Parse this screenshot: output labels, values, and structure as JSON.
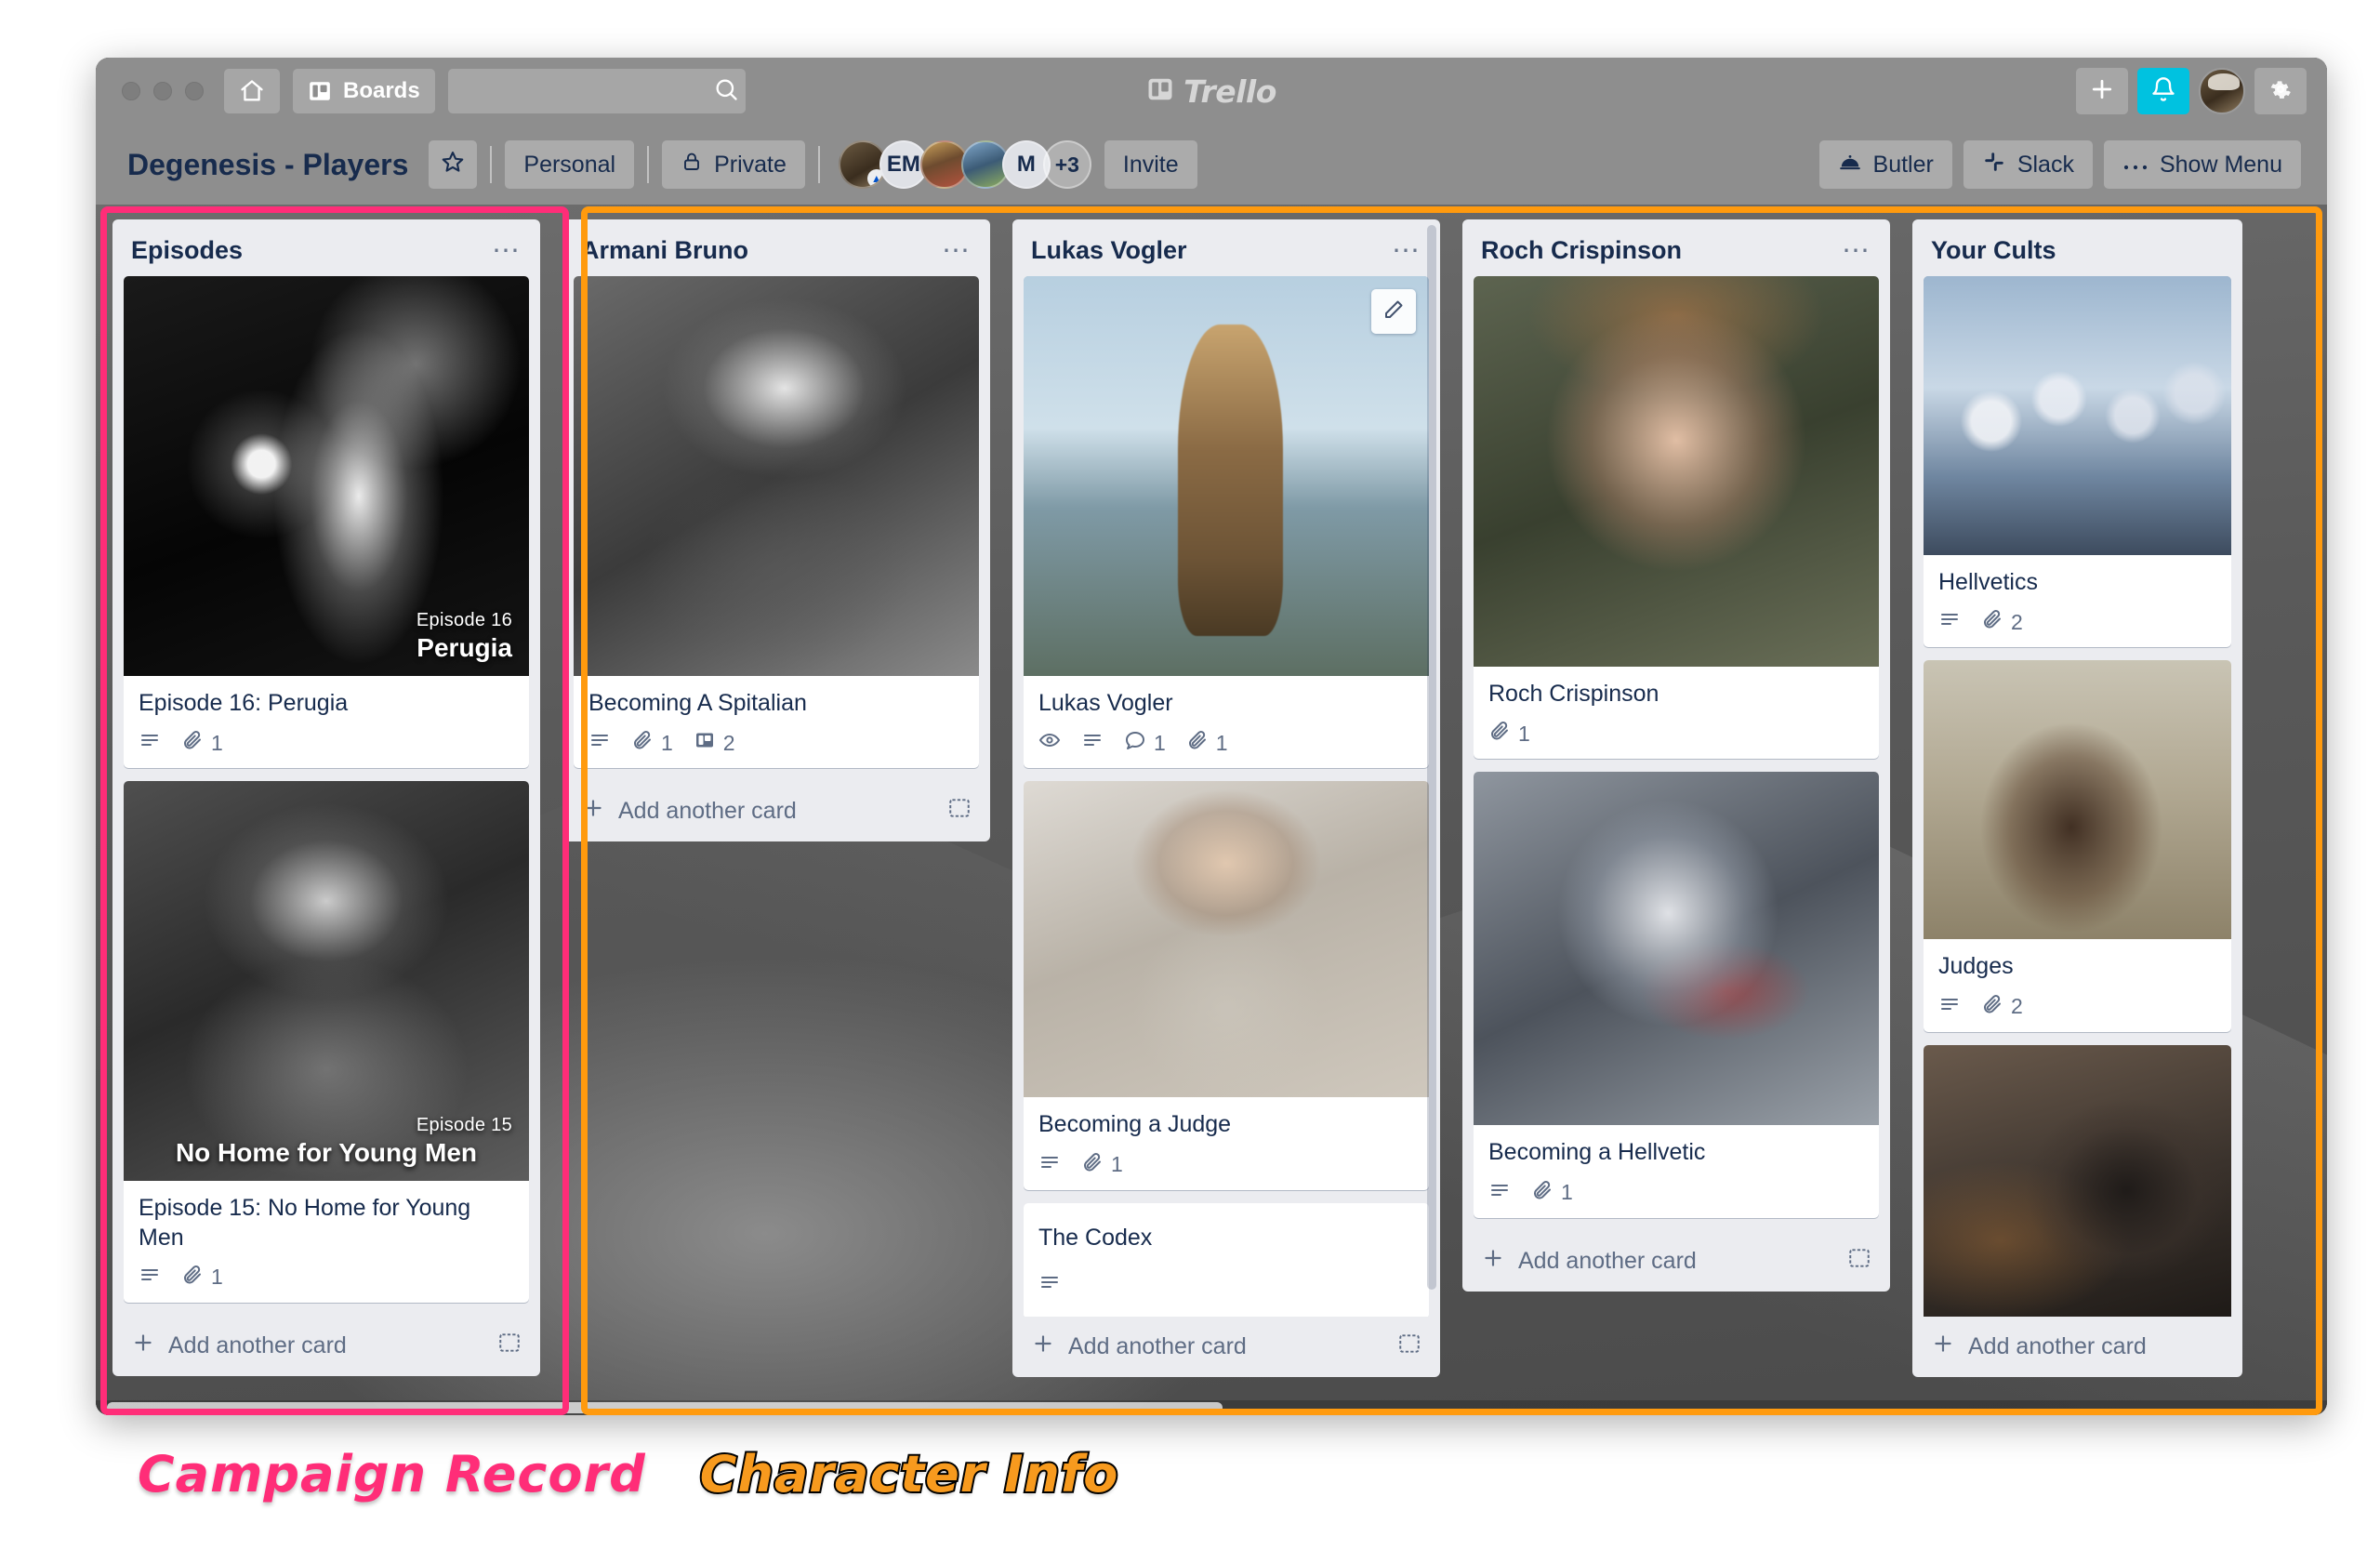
{
  "window": {
    "topbar": {
      "home_icon": "home-icon",
      "boards_label": "Boards",
      "boards_icon": "boards-icon",
      "search_placeholder": "",
      "search_value": "",
      "search_icon": "search-icon",
      "logo_text": "Trello",
      "logo_icon": "trello-logo-icon",
      "add_icon": "plus-icon",
      "notifications_icon": "bell-icon",
      "avatar_icon": "user-avatar",
      "settings_icon": "gear-icon"
    },
    "boardbar": {
      "title": "Degenesis - Players",
      "star_icon": "star-icon",
      "workspace_label": "Personal",
      "visibility_label": "Private",
      "lock_icon": "lock-icon",
      "members": [
        {
          "type": "photo",
          "label": ""
        },
        {
          "type": "initials",
          "label": "EM"
        },
        {
          "type": "photo",
          "label": ""
        },
        {
          "type": "photo",
          "label": ""
        },
        {
          "type": "initials",
          "label": "M"
        },
        {
          "type": "overflow",
          "label": "+3"
        }
      ],
      "invite_label": "Invite",
      "butler_label": "Butler",
      "butler_icon": "butler-icon",
      "slack_label": "Slack",
      "slack_icon": "slack-icon",
      "menu_label": "Show Menu",
      "menu_icon": "ellipsis-icon"
    }
  },
  "board": {
    "add_card_label": "Add another card",
    "lists": [
      {
        "title": "Episodes",
        "highlight": "pink",
        "show_add_card": true,
        "cards": [
          {
            "title": "Episode 16: Perugia",
            "cover": "cover-perugia",
            "cover_caption_tag": "Episode 16",
            "cover_caption_name": "Perugia",
            "badges": [
              {
                "icon": "description-icon",
                "count": ""
              },
              {
                "icon": "attachment-icon",
                "count": "1"
              }
            ]
          },
          {
            "title": "Episode 15: No Home for Young Men",
            "cover": "cover-nohome",
            "cover_caption_tag": "Episode 15",
            "cover_caption_name": "No Home for Young Men",
            "badges": [
              {
                "icon": "description-icon",
                "count": ""
              },
              {
                "icon": "attachment-icon",
                "count": "1"
              }
            ]
          }
        ]
      },
      {
        "title": "Armani Bruno",
        "highlight": "orange",
        "show_add_card": true,
        "cards": [
          {
            "title": "Becoming A Spitalian",
            "cover": "cover-spitalian",
            "cover_caption_tag": "",
            "cover_caption_name": "",
            "badges": [
              {
                "icon": "description-icon",
                "count": ""
              },
              {
                "icon": "attachment-icon",
                "count": "1"
              },
              {
                "icon": "card-cover-icon",
                "count": "2"
              }
            ]
          }
        ]
      },
      {
        "title": "Lukas Vogler",
        "highlight": "none",
        "show_add_card": true,
        "cards": [
          {
            "title": "Lukas Vogler",
            "cover": "cover-lukas",
            "cover_caption_tag": "",
            "cover_caption_name": "",
            "edit_icon": "pencil-icon",
            "badges": [
              {
                "icon": "watch-eye-icon",
                "count": ""
              },
              {
                "icon": "description-icon",
                "count": ""
              },
              {
                "icon": "comment-icon",
                "count": "1"
              },
              {
                "icon": "attachment-icon",
                "count": "1"
              }
            ]
          },
          {
            "title": "Becoming a Judge",
            "cover": "cover-judge",
            "cover_caption_tag": "",
            "cover_caption_name": "",
            "badges": [
              {
                "icon": "description-icon",
                "count": ""
              },
              {
                "icon": "attachment-icon",
                "count": "1"
              }
            ]
          },
          {
            "title": "The Codex",
            "cover": "",
            "cover_caption_tag": "",
            "cover_caption_name": "",
            "badges": [
              {
                "icon": "description-icon",
                "count": ""
              }
            ]
          }
        ]
      },
      {
        "title": "Roch Crispinson",
        "highlight": "none",
        "show_add_card": true,
        "cards": [
          {
            "title": "Roch Crispinson",
            "cover": "cover-roch",
            "cover_caption_tag": "",
            "cover_caption_name": "",
            "badges": [
              {
                "icon": "attachment-icon",
                "count": "1"
              }
            ]
          },
          {
            "title": "Becoming a Hellvetic",
            "cover": "cover-hellvetic",
            "cover_caption_tag": "",
            "cover_caption_name": "",
            "badges": [
              {
                "icon": "description-icon",
                "count": ""
              },
              {
                "icon": "attachment-icon",
                "count": "1"
              }
            ]
          }
        ]
      },
      {
        "title": "Your Cults",
        "highlight": "orange",
        "show_add_card": true,
        "cards": [
          {
            "title": "Hellvetics",
            "cover": "cover-hellvetics-cult",
            "cover_caption_tag": "",
            "cover_caption_name": "",
            "badges": [
              {
                "icon": "description-icon",
                "count": ""
              },
              {
                "icon": "attachment-icon",
                "count": "2"
              }
            ]
          },
          {
            "title": "Judges",
            "cover": "cover-judges-cult",
            "cover_caption_tag": "",
            "cover_caption_name": "",
            "badges": [
              {
                "icon": "description-icon",
                "count": ""
              },
              {
                "icon": "attachment-icon",
                "count": "2"
              }
            ]
          },
          {
            "title": "",
            "cover": "cover-dark-rider",
            "cover_caption_tag": "",
            "cover_caption_name": "",
            "badges": []
          }
        ]
      }
    ]
  },
  "annotations": [
    {
      "label": "Campaign Record",
      "color": "#ff2d78",
      "style": "pink"
    },
    {
      "label": "Character Info",
      "color": "#f79a1e",
      "style": "orange"
    }
  ]
}
